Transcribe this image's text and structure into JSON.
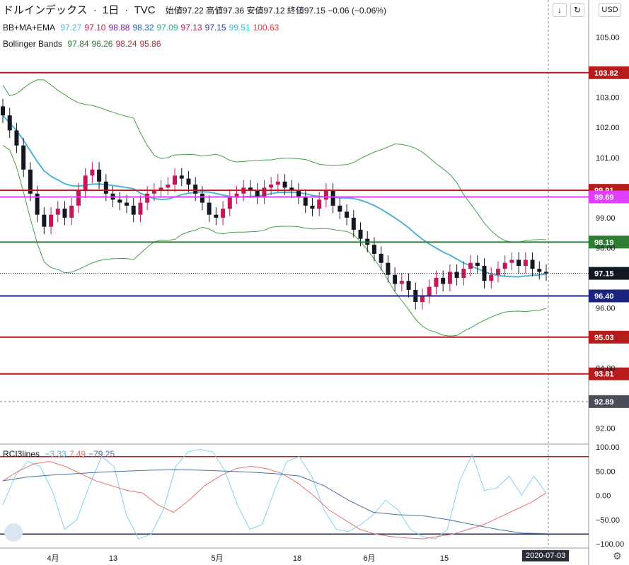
{
  "header": {
    "symbol": "ドルインデックス",
    "interval": "1日",
    "source": "TVC",
    "sep": "·",
    "ohlc": "始値97.22 高値97.36 安値97.12 終値97.15 −0.06 (−0.06%)",
    "currency": "USD"
  },
  "indicators": {
    "bbmaema": {
      "name": "BB+MA+EMA",
      "values": [
        "97.27",
        "97.10",
        "98.88",
        "98.32",
        "97.09",
        "97.13",
        "97.15",
        "99.51",
        "100.63"
      ],
      "colors": [
        "#4fb3d9",
        "#c2185b",
        "#7b1fa2",
        "#1565c0",
        "#26a69a",
        "#ad1457",
        "#283593",
        "#26c6da",
        "#e53935"
      ]
    },
    "bollinger": {
      "name": "Bollinger Bands",
      "values": [
        "97.84",
        "96.26",
        "98.24",
        "95.86"
      ],
      "colors": [
        "#2e7d32",
        "#2e7d32",
        "#c62828",
        "#c62828"
      ]
    },
    "rci": {
      "name": "RCI3lines",
      "values": [
        "−3.33",
        "7.49",
        "−79.25"
      ],
      "colors": [
        "#4fb3d9",
        "#e57373",
        "#4a6fa5"
      ]
    }
  },
  "date_badge": "2020-07-03",
  "chart_data": [
    {
      "type": "candlestick",
      "title": "ドルインデックス · 1日 · TVC",
      "ylim": [
        91.5,
        106.0
      ],
      "y_ticks": [
        "92.00",
        "94.00",
        "96.00",
        "98.00",
        "99.00",
        "101.00",
        "102.00",
        "103.00",
        "105.00"
      ],
      "x_ticks": [
        "4月",
        "13",
        "5月",
        "18",
        "6月",
        "15"
      ],
      "horizontal_lines": [
        {
          "value": 103.82,
          "label": "103.82",
          "color": "#b71c1c"
        },
        {
          "value": 99.91,
          "label": "99.91",
          "color": "#b71c1c"
        },
        {
          "value": 99.69,
          "label": "99.69",
          "color": "#e040fb"
        },
        {
          "value": 98.19,
          "label": "98.19",
          "color": "#2e7d32"
        },
        {
          "value": 96.4,
          "label": "96.40",
          "color": "#1a237e"
        },
        {
          "value": 95.03,
          "label": "95.03",
          "color": "#b71c1c"
        },
        {
          "value": 93.81,
          "label": "93.81",
          "color": "#b71c1c"
        }
      ],
      "last_price": {
        "value": 97.15,
        "label": "97.15"
      },
      "crosshair_price": {
        "value": 92.89,
        "label": "92.89"
      },
      "closes": [
        102.4,
        101.9,
        101.4,
        100.6,
        99.8,
        99.1,
        98.7,
        99.1,
        99.3,
        99.0,
        99.4,
        99.9,
        100.4,
        100.6,
        100.2,
        99.8,
        99.6,
        99.5,
        99.4,
        99.1,
        99.5,
        99.8,
        99.9,
        100.0,
        100.1,
        100.4,
        100.3,
        100.1,
        99.8,
        99.5,
        99.1,
        99.0,
        99.3,
        99.7,
        99.8,
        100.0,
        99.9,
        99.7,
        100.0,
        100.1,
        100.2,
        100.0,
        99.9,
        99.7,
        99.4,
        99.3,
        99.6,
        99.9,
        99.4,
        99.2,
        99.0,
        98.6,
        98.3,
        98.1,
        97.8,
        97.5,
        97.1,
        96.8,
        96.9,
        96.6,
        96.2,
        96.4,
        96.7,
        97.0,
        96.8,
        97.2,
        97.0,
        97.3,
        97.5,
        97.4,
        96.9,
        97.1,
        97.3,
        97.5,
        97.6,
        97.4,
        97.6,
        97.3,
        97.2,
        97.15
      ],
      "rci": {
        "ylim": [
          -100,
          100
        ],
        "y_ticks": [
          "100.00",
          "50.00",
          "0.00",
          "−50.00",
          "−100.00"
        ],
        "levels": [
          80,
          -80
        ],
        "short": [
          -20,
          40,
          70,
          60,
          10,
          -70,
          -50,
          20,
          80,
          60,
          -40,
          -90,
          -80,
          -30,
          60,
          90,
          95,
          90,
          50,
          -20,
          -70,
          -60,
          10,
          70,
          80,
          40,
          -30,
          -70,
          -75,
          -60,
          -40,
          -10,
          -30,
          -70,
          -85,
          -90,
          -70,
          30,
          85,
          10,
          15,
          40,
          0,
          40,
          5
        ],
        "mid": [
          30,
          50,
          65,
          70,
          60,
          45,
          30,
          20,
          10,
          5,
          -20,
          -35,
          -10,
          20,
          40,
          55,
          60,
          55,
          45,
          25,
          0,
          -30,
          -50,
          -70,
          -80,
          -85,
          -88,
          -90,
          -85,
          -80,
          -70,
          -60,
          -45,
          -30,
          -15,
          5
        ],
        "long": [
          30,
          38,
          42,
          45,
          48,
          50,
          52,
          53,
          52,
          50,
          48,
          45,
          40,
          20,
          -10,
          -35,
          -40,
          -42,
          -50,
          -60,
          -70,
          -78,
          -79
        ]
      }
    }
  ]
}
